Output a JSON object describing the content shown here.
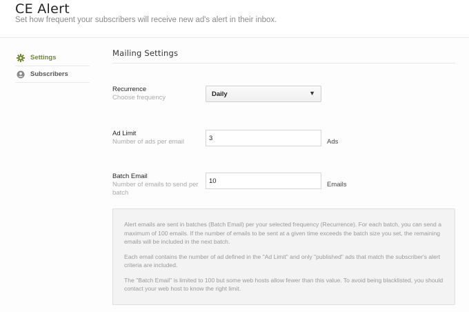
{
  "header": {
    "title": "CE Alert",
    "subtitle": "Set how frequent your subscribers will receive new ad's alert in their inbox."
  },
  "sidebar": {
    "items": [
      {
        "label": "Settings",
        "icon": "gear-icon",
        "active": true
      },
      {
        "label": "Subscribers",
        "icon": "user-icon",
        "active": false
      }
    ]
  },
  "main": {
    "section_title": "Mailing Settings",
    "fields": {
      "recurrence": {
        "label": "Recurrence",
        "help": "Choose frequency",
        "value": "Daily"
      },
      "ad_limit": {
        "label": "Ad Limit",
        "help": "Number of ads per email",
        "value": "3",
        "unit": "Ads"
      },
      "batch_email": {
        "label": "Batch Email",
        "help": "Number of emails to send per batch",
        "value": "10",
        "unit": "Emails"
      }
    },
    "info": [
      "Alert emails are sent in batches (Batch Email) per your selected frequency (Recurrence). For each batch, you can send a maximum of 100 emails. If the number of emails to be sent at a given time exceeds the batch size you set, the remaining emails will be included in the next batch.",
      "Each email contains the number of ad defined in the \"Ad Limit\" and only \"published\" ads that match the subscriber's alert criteria are included.",
      "The \"Batch Email\" is limited to 100 but some web hosts allow fewer than this value. To avoid being blacklisted, you should contact your web host to know the right limit."
    ]
  },
  "colors": {
    "accent": "#6e8a2e",
    "muted_text": "#aaaaaa",
    "info_bg": "#f3f3f3"
  }
}
